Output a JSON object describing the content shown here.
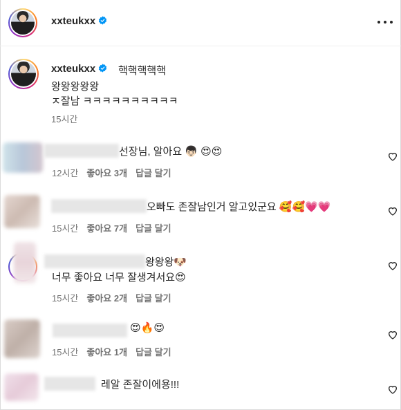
{
  "post": {
    "username": "xxteukxx",
    "caption_line1": "핵핵핵핵핵",
    "caption_line2": "왕왕왕왕왕",
    "caption_line3": "ㅈ잘남 ㅋㅋㅋㅋㅋㅋㅋㅋㅋㅋ",
    "time": "15시간"
  },
  "comments": [
    {
      "text": "선장님, 알아요 👦🏻 😍😍",
      "time": "12시간",
      "likes": "좋아요 3개",
      "reply": "답글 달기"
    },
    {
      "text": "오빠도 존잘남인거 알고있군요 🥰🥰💗💗",
      "time": "15시간",
      "likes": "좋아요 7개",
      "reply": "답글 달기"
    },
    {
      "text_line1": "왕왕왕🐶",
      "text_line2": "너무 좋아요 너무 잘생겨서요😍",
      "time": "15시간",
      "likes": "좋아요 2개",
      "reply": "답글 달기"
    },
    {
      "text": "😍🔥😍",
      "time": "15시간",
      "likes": "좋아요 1개",
      "reply": "답글 달기"
    },
    {
      "text": "레알 존잘이에용!!!"
    }
  ],
  "icons": {
    "verified": "verified-badge-icon",
    "more": "more-options-icon",
    "heart": "heart-outline-icon"
  },
  "colors": {
    "verified": "#0095f6",
    "text": "#262626",
    "secondary": "#737373"
  }
}
